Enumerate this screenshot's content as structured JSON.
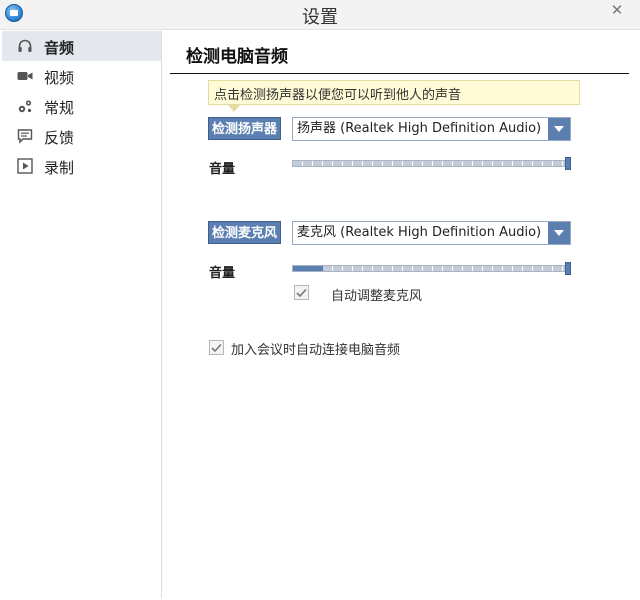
{
  "window": {
    "title": "设置",
    "close_glyph": "✕",
    "app_icon": "camera-app-icon"
  },
  "sidebar": {
    "items": [
      {
        "label": "音频",
        "icon": "headphones-icon",
        "active": true
      },
      {
        "label": "视频",
        "icon": "video-camera-icon",
        "active": false
      },
      {
        "label": "常规",
        "icon": "gears-icon",
        "active": false
      },
      {
        "label": "反馈",
        "icon": "speech-bubble-icon",
        "active": false
      },
      {
        "label": "录制",
        "icon": "play-icon",
        "active": false
      }
    ]
  },
  "main": {
    "section_title": "检测电脑音频",
    "tooltip": "点击检测扬声器以便您可以听到他人的声音",
    "speaker": {
      "test_button": "检测扬声器",
      "device": "扬声器 (Realtek High Definition Audio)",
      "volume_label": "音量",
      "volume_level": 1.0
    },
    "microphone": {
      "test_button": "检测麦克风",
      "device": "麦克风 (Realtek High Definition Audio)",
      "volume_label": "音量",
      "volume_level": 1.0,
      "input_level": 0.11,
      "auto_adjust": {
        "label": "自动调整麦克风",
        "checked": true
      }
    },
    "auto_join_audio": {
      "label": "加入会议时自动连接电脑音频",
      "checked": true
    }
  },
  "colors": {
    "accent": "#5b7fb1",
    "tooltip_bg": "#fffbd6",
    "active_item_bg": "#e4e8ee"
  }
}
